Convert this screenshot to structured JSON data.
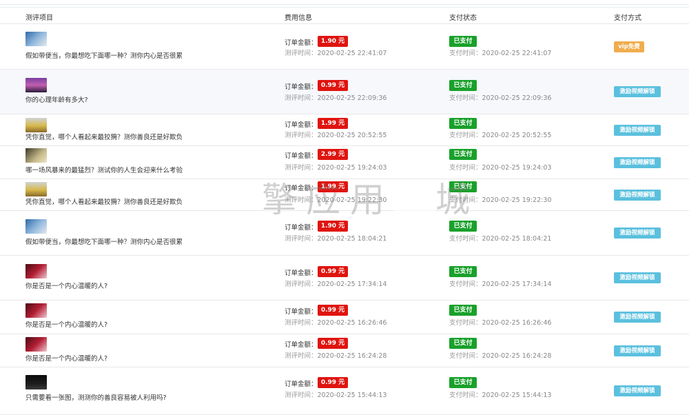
{
  "header": {
    "col_item": "测评项目",
    "col_fee": "费用信息",
    "col_status": "支付状态",
    "col_method": "支付方式"
  },
  "labels": {
    "order_amount": "订单金额：",
    "eval_time": "测评时间：",
    "pay_time": "支付时间："
  },
  "watermark": {
    "left": "擎应用",
    "right": "城"
  },
  "rows": [
    {
      "title": "假如带便当，你最想吃下面哪一种？测你内心是否很累",
      "price": "1.90 元",
      "eval_time": "2020-02-25 22:41:07",
      "status": "已支付",
      "pay_time": "2020-02-25 22:41:07",
      "method": "vip免费",
      "thumb": "blue-landscape"
    },
    {
      "title": "你的心理年龄有多大?",
      "price": "0.99 元",
      "eval_time": "2020-02-25 22:09:36",
      "status": "已支付",
      "pay_time": "2020-02-25 22:09:36",
      "method": "激励视频解锁",
      "thumb": "purple-sunset"
    },
    {
      "title": "凭你直觉，哪个人看起来最狡猾？测你善良还是好欺负",
      "price": "1.99 元",
      "eval_time": "2020-02-25 20:52:55",
      "status": "已支付",
      "pay_time": "2020-02-25 20:52:55",
      "method": "激励视频解锁",
      "thumb": "yellow-field"
    },
    {
      "title": "哪一场风暴来的最猛烈？测试你的人生会迎来什么考验",
      "price": "2.99 元",
      "eval_time": "2020-02-25 19:24:03",
      "status": "已支付",
      "pay_time": "2020-02-25 19:24:03",
      "method": "激励视频解锁",
      "thumb": "olive-portrait"
    },
    {
      "title": "凭你直觉，哪个人看起来最狡猾？测你善良还是好欺负",
      "price": "1.99 元",
      "eval_time": "2020-02-25 19:22:30",
      "status": "已支付",
      "pay_time": "2020-02-25 19:22:30",
      "method": "激励视频解锁",
      "thumb": "yellow-field"
    },
    {
      "title": "假如带便当，你最想吃下面哪一种？测你内心是否很累",
      "price": "1.90 元",
      "eval_time": "2020-02-25 18:04:21",
      "status": "已支付",
      "pay_time": "2020-02-25 18:04:21",
      "method": "激励视频解锁",
      "thumb": "blue-landscape"
    },
    {
      "title": "你是否是一个内心温暖的人?",
      "price": "0.99 元",
      "eval_time": "2020-02-25 17:34:14",
      "status": "已支付",
      "pay_time": "2020-02-25 17:34:14",
      "method": "激励视频解锁",
      "thumb": "red-hands"
    },
    {
      "title": "你是否是一个内心温暖的人?",
      "price": "0.99 元",
      "eval_time": "2020-02-25 16:26:46",
      "status": "已支付",
      "pay_time": "2020-02-25 16:26:46",
      "method": "激励视频解锁",
      "thumb": "red-hands"
    },
    {
      "title": "你是否是一个内心温暖的人?",
      "price": "0.99 元",
      "eval_time": "2020-02-25 16:24:28",
      "status": "已支付",
      "pay_time": "2020-02-25 16:24:28",
      "method": "激励视频解锁",
      "thumb": "red-hands"
    },
    {
      "title": "只需要看一张图，测测你的善良容易被人利用吗?",
      "price": "0.99 元",
      "eval_time": "2020-02-25 15:44:13",
      "status": "已支付",
      "pay_time": "2020-02-25 15:44:13",
      "method": "激励视频解锁",
      "thumb": "black-figures"
    }
  ],
  "colors": {
    "price_bg": "#e0140f",
    "paid_bg": "#19a12b",
    "vip_bg": "#f0ad4e",
    "unlock_bg": "#5bc0de"
  }
}
